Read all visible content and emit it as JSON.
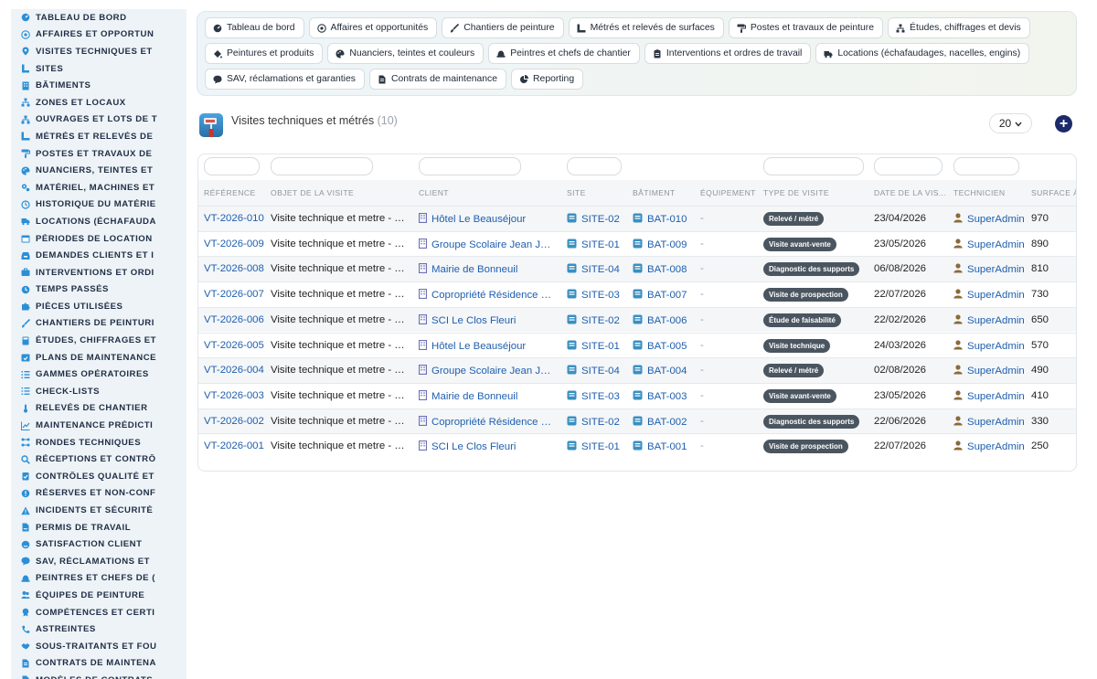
{
  "sidebar": {
    "items": [
      {
        "label": "TABLEAU DE BORD",
        "icon": "dashboard-icon"
      },
      {
        "label": "AFFAIRES ET OPPORTUN",
        "icon": "target-icon"
      },
      {
        "label": "VISITES TECHNIQUES ET",
        "icon": "map-pin-icon"
      },
      {
        "label": "SITES",
        "icon": "ruler-icon"
      },
      {
        "label": "BÂTIMENTS",
        "icon": "building-icon"
      },
      {
        "label": "ZONES ET LOCAUX",
        "icon": "sitemap-icon"
      },
      {
        "label": "OUVRAGES ET LOTS DE T",
        "icon": "network-icon"
      },
      {
        "label": "MÉTRÉS ET RELEVÉS DE",
        "icon": "ruler-combined-icon"
      },
      {
        "label": "POSTES ET TRAVAUX DE",
        "icon": "paint-roller-icon"
      },
      {
        "label": "NUANCIERS, TEINTES ET",
        "icon": "palette-icon"
      },
      {
        "label": "MATÉRIEL, MACHINES ET",
        "icon": "cogs-icon"
      },
      {
        "label": "HISTORIQUE DU MATÉRIE",
        "icon": "history-icon"
      },
      {
        "label": "LOCATIONS (ÉCHAFAUDA",
        "icon": "truck-icon"
      },
      {
        "label": "PÉRIODES DE LOCATION",
        "icon": "calendar-icon"
      },
      {
        "label": "DEMANDES CLIENTS ET I",
        "icon": "inbox-icon"
      },
      {
        "label": "INTERVENTIONS ET ORDI",
        "icon": "briefcase-icon"
      },
      {
        "label": "TEMPS PASSÉS",
        "icon": "clock-icon"
      },
      {
        "label": "PIÈCES UTILISÉES",
        "icon": "puzzle-icon"
      },
      {
        "label": "CHANTIERS DE PEINTURI",
        "icon": "brush-icon"
      },
      {
        "label": "ÉTUDES, CHIFFRAGES ET",
        "icon": "calculator-icon"
      },
      {
        "label": "PLANS DE MAINTENANCE",
        "icon": "calendar-check-icon"
      },
      {
        "label": "GAMMES OPÉRATOIRES",
        "icon": "list-ol-icon"
      },
      {
        "label": "CHECK-LISTS",
        "icon": "checklist-icon"
      },
      {
        "label": "RELEVÉS DE CHANTIER",
        "icon": "thermometer-icon"
      },
      {
        "label": "MAINTENANCE PRÉDICTI",
        "icon": "chart-line-icon"
      },
      {
        "label": "RONDES TECHNIQUES",
        "icon": "route-icon"
      },
      {
        "label": "RÉCEPTIONS ET CONTRÔ",
        "icon": "search-icon"
      },
      {
        "label": "CONTRÔLES QUALITÉ ET",
        "icon": "clipboard-check-icon"
      },
      {
        "label": "RÉSERVES ET NON-CONF",
        "icon": "alert-circle-icon"
      },
      {
        "label": "INCIDENTS ET SÉCURITÉ",
        "icon": "warning-icon"
      },
      {
        "label": "PERMIS DE TRAVAIL",
        "icon": "file-signature-icon"
      },
      {
        "label": "SATISFACTION CLIENT",
        "icon": "smile-icon"
      },
      {
        "label": "SAV, RÉCLAMATIONS ET",
        "icon": "comment-icon"
      },
      {
        "label": "PEINTRES ET CHEFS DE (",
        "icon": "hard-hat-icon"
      },
      {
        "label": "ÉQUIPES DE PEINTURE",
        "icon": "users-icon"
      },
      {
        "label": "COMPÉTENCES ET CERTI",
        "icon": "certificate-icon"
      },
      {
        "label": "ASTREINTES",
        "icon": "phone-icon"
      },
      {
        "label": "SOUS-TRAITANTS ET FOU",
        "icon": "handshake-icon"
      },
      {
        "label": "CONTRATS DE MAINTENA",
        "icon": "file-contract-icon"
      },
      {
        "label": "MODÈLES DE CONTRATS",
        "icon": "file-icon"
      }
    ]
  },
  "tabs": [
    {
      "label": "Tableau de bord",
      "icon": "dashboard-icon"
    },
    {
      "label": "Affaires et opportunités",
      "icon": "target-icon"
    },
    {
      "label": "Chantiers de peinture",
      "icon": "brush-icon"
    },
    {
      "label": "Métrés et relevés de surfaces",
      "icon": "ruler-combined-icon"
    },
    {
      "label": "Postes et travaux de peinture",
      "icon": "paint-roller-icon"
    },
    {
      "label": "Études, chiffrages et devis",
      "icon": "sitemap-icon"
    },
    {
      "label": "Peintures et produits",
      "icon": "fill-drip-icon"
    },
    {
      "label": "Nuanciers, teintes et couleurs",
      "icon": "palette-icon"
    },
    {
      "label": "Peintres et chefs de chantier",
      "icon": "hard-hat-icon"
    },
    {
      "label": "Interventions et ordres de travail",
      "icon": "clipboard-icon"
    },
    {
      "label": "Locations (échafaudages, nacelles, engins)",
      "icon": "truck-icon"
    },
    {
      "label": "SAV, réclamations et garanties",
      "icon": "comment-icon"
    },
    {
      "label": "Contrats de maintenance",
      "icon": "file-contract-icon"
    },
    {
      "label": "Reporting",
      "icon": "chart-pie-icon"
    }
  ],
  "page": {
    "title": "Visites techniques et métrés",
    "count": "(10)",
    "page_size": "20",
    "add_button_icon": "plus-circle-icon"
  },
  "table": {
    "columns": [
      "RÉFÉRENCE",
      "OBJET DE LA VISITE",
      "CLIENT",
      "SITE",
      "BÂTIMENT",
      "ÉQUIPEMENT",
      "TYPE DE VISITE",
      "DATE DE LA VIS...",
      "TECHNICIEN",
      "SURFACE À"
    ],
    "rows": [
      {
        "ref": "VT-2026-010",
        "objet": "Visite technique et metre - De...",
        "client": "Hôtel Le Beauséjour",
        "site": "SITE-02",
        "batiment": "BAT-010",
        "equipement": "-",
        "type": "Relevé / métré",
        "date": "23/04/2026",
        "technicien": "SuperAdmin",
        "surface": "970"
      },
      {
        "ref": "VT-2026-009",
        "objet": "Visite technique et metre - Co...",
        "client": "Groupe Scolaire Jean Jau...",
        "site": "SITE-01",
        "batiment": "BAT-009",
        "equipement": "-",
        "type": "Visite avant-vente",
        "date": "23/05/2026",
        "technicien": "SuperAdmin",
        "surface": "890"
      },
      {
        "ref": "VT-2026-008",
        "objet": "Visite technique et metre - Re...",
        "client": "Mairie de Bonneuil",
        "site": "SITE-04",
        "batiment": "BAT-008",
        "equipement": "-",
        "type": "Diagnostic des supports",
        "date": "06/08/2026",
        "technicien": "SuperAdmin",
        "surface": "810"
      },
      {
        "ref": "VT-2026-007",
        "objet": "Visite technique et metre - Pe...",
        "client": "Copropriété Résidence du...",
        "site": "SITE-03",
        "batiment": "BAT-007",
        "equipement": "-",
        "type": "Visite de prospection",
        "date": "22/07/2026",
        "technicien": "SuperAdmin",
        "surface": "730"
      },
      {
        "ref": "VT-2026-006",
        "objet": "Visite technique et metre - Re...",
        "client": "SCI Le Clos Fleuri",
        "site": "SITE-02",
        "batiment": "BAT-006",
        "equipement": "-",
        "type": "Étude de faisabilité",
        "date": "22/02/2026",
        "technicien": "SuperAdmin",
        "surface": "650"
      },
      {
        "ref": "VT-2026-005",
        "objet": "Visite technique et metre - Ra...",
        "client": "Hôtel Le Beauséjour",
        "site": "SITE-01",
        "batiment": "BAT-005",
        "equipement": "-",
        "type": "Visite technique",
        "date": "24/03/2026",
        "technicien": "SuperAdmin",
        "surface": "570"
      },
      {
        "ref": "VT-2026-004",
        "objet": "Visite technique et metre - De...",
        "client": "Groupe Scolaire Jean Jau...",
        "site": "SITE-04",
        "batiment": "BAT-004",
        "equipement": "-",
        "type": "Relevé / métré",
        "date": "02/08/2026",
        "technicien": "SuperAdmin",
        "surface": "490"
      },
      {
        "ref": "VT-2026-003",
        "objet": "Visite technique et metre - Co...",
        "client": "Mairie de Bonneuil",
        "site": "SITE-03",
        "batiment": "BAT-003",
        "equipement": "-",
        "type": "Visite avant-vente",
        "date": "23/05/2026",
        "technicien": "SuperAdmin",
        "surface": "410"
      },
      {
        "ref": "VT-2026-002",
        "objet": "Visite technique et metre - Re...",
        "client": "Copropriété Résidence du...",
        "site": "SITE-02",
        "batiment": "BAT-002",
        "equipement": "-",
        "type": "Diagnostic des supports",
        "date": "22/06/2026",
        "technicien": "SuperAdmin",
        "surface": "330"
      },
      {
        "ref": "VT-2026-001",
        "objet": "Visite technique et metre - Pe...",
        "client": "SCI Le Clos Fleuri",
        "site": "SITE-01",
        "batiment": "BAT-001",
        "equipement": "-",
        "type": "Visite de prospection",
        "date": "22/07/2026",
        "technicien": "SuperAdmin",
        "surface": "250"
      }
    ]
  },
  "colors": {
    "link": "#1f5fae",
    "badge_bg": "#4a5560",
    "sidebar_bg": "#eef3f7",
    "sidebar_icon": "#2b8fd6",
    "add_button": "#1b2a6b",
    "user_icon": "#8a6a3a",
    "building_icon": "#6d6fb8",
    "site_icon": "#3a8fc0"
  }
}
